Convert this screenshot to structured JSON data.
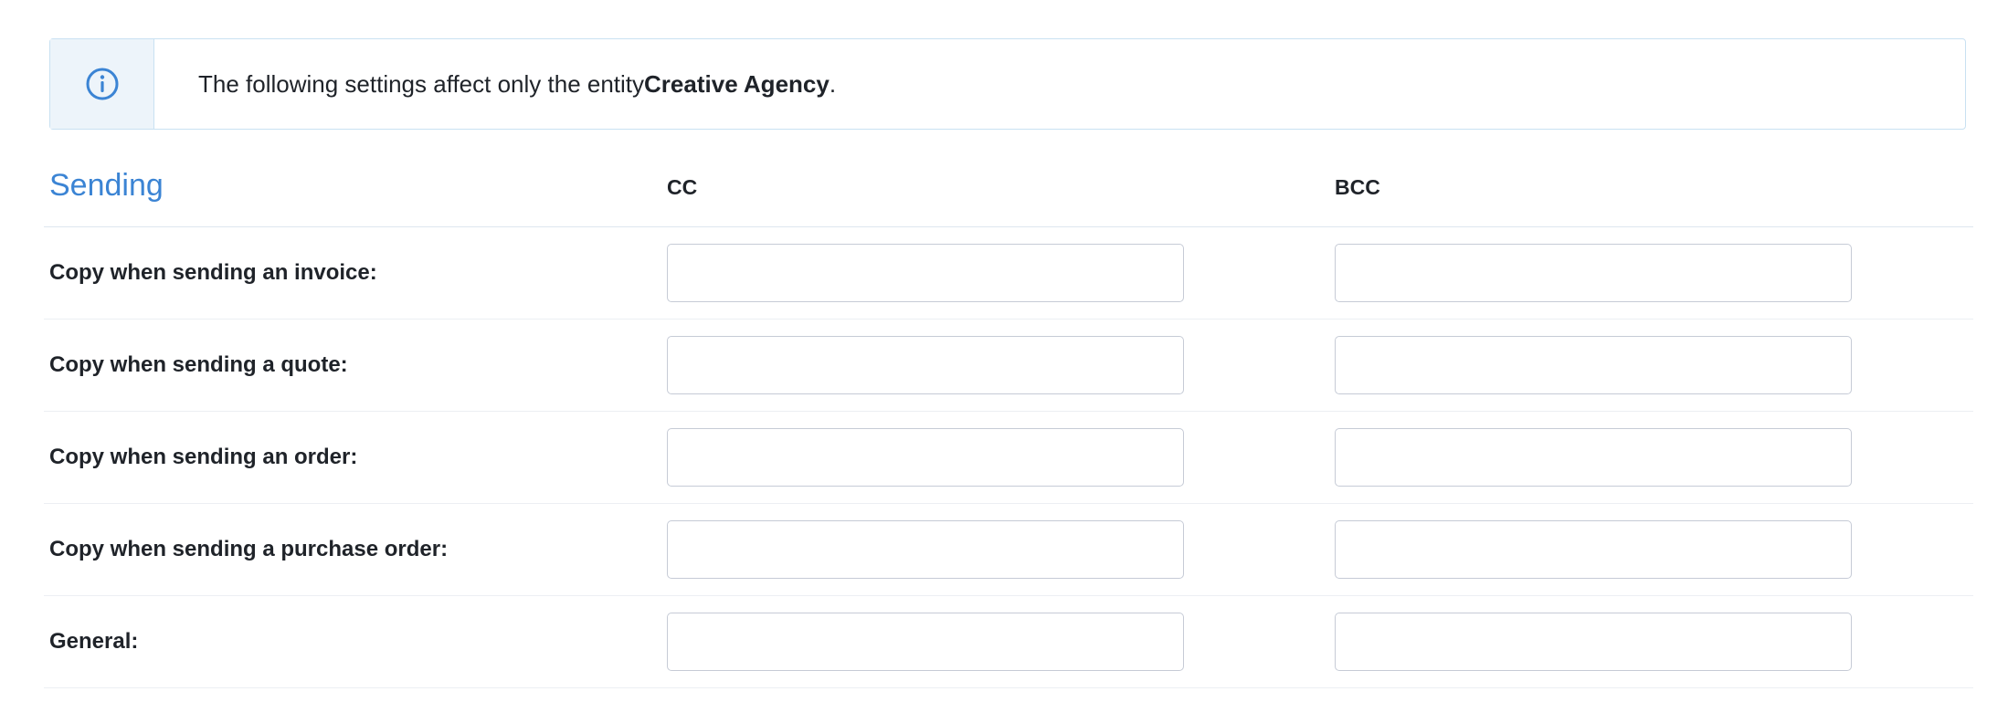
{
  "notice": {
    "icon": "info-icon",
    "text_prefix": "The following settings affect only the entity ",
    "entity": "Creative Agency",
    "text_suffix": ".",
    "colors": {
      "border": "#c9e1f2",
      "icon_bg": "#edf4fa",
      "icon": "#3b84d4"
    }
  },
  "section": {
    "title": "Sending",
    "title_color": "#3b84d4",
    "columns": {
      "cc": "CC",
      "bcc": "BCC"
    }
  },
  "rows": [
    {
      "label": "Copy when sending an invoice:",
      "cc": "",
      "bcc": ""
    },
    {
      "label": "Copy when sending a quote:",
      "cc": "",
      "bcc": ""
    },
    {
      "label": "Copy when sending an order:",
      "cc": "",
      "bcc": ""
    },
    {
      "label": "Copy when sending a purchase order:",
      "cc": "",
      "bcc": ""
    },
    {
      "label": "General:",
      "cc": "",
      "bcc": ""
    }
  ]
}
